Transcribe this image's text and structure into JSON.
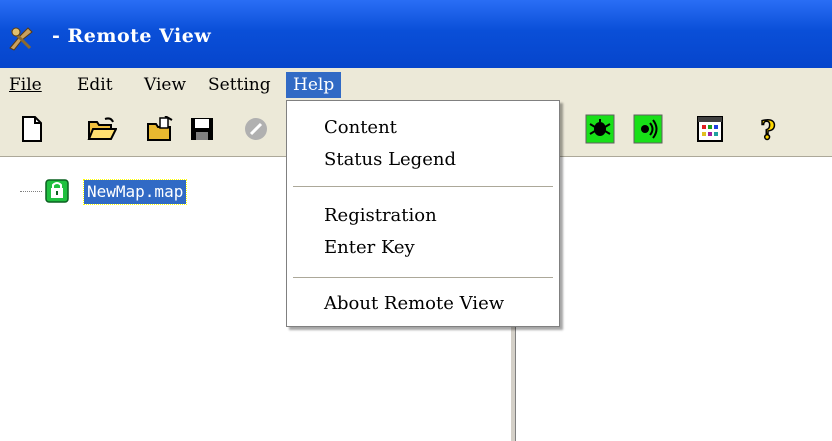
{
  "window": {
    "title": "- Remote View",
    "app_icon": "remote-view-app-icon"
  },
  "menubar": {
    "items": [
      {
        "label": "File",
        "accel": "F"
      },
      {
        "label": "Edit",
        "accel": "E"
      },
      {
        "label": "View",
        "accel": "V"
      },
      {
        "label": "Setting",
        "accel": "S"
      },
      {
        "label": "Help",
        "accel": "H",
        "active": true
      }
    ]
  },
  "toolbar": {
    "buttons": [
      {
        "icon": "new-document-icon"
      },
      {
        "icon": "open-folder-icon"
      },
      {
        "icon": "open-file-icon"
      },
      {
        "icon": "save-disk-icon"
      },
      {
        "icon": "disabled-stop-icon"
      },
      {
        "icon": "green-bug-icon"
      },
      {
        "icon": "green-sound-icon"
      },
      {
        "icon": "calendar-grid-icon"
      },
      {
        "icon": "help-question-icon"
      }
    ]
  },
  "tree": {
    "node_label": "NewMap.map",
    "node_icon": "map-node-icon"
  },
  "help_menu": {
    "items": [
      "Content",
      "Status Legend",
      "Registration",
      "Enter Key",
      "About Remote View"
    ]
  },
  "colors": {
    "titlebar": "#0a4fd8",
    "selection": "#316ac5",
    "chrome": "#ece9d8",
    "green_icon": "#10e010"
  }
}
